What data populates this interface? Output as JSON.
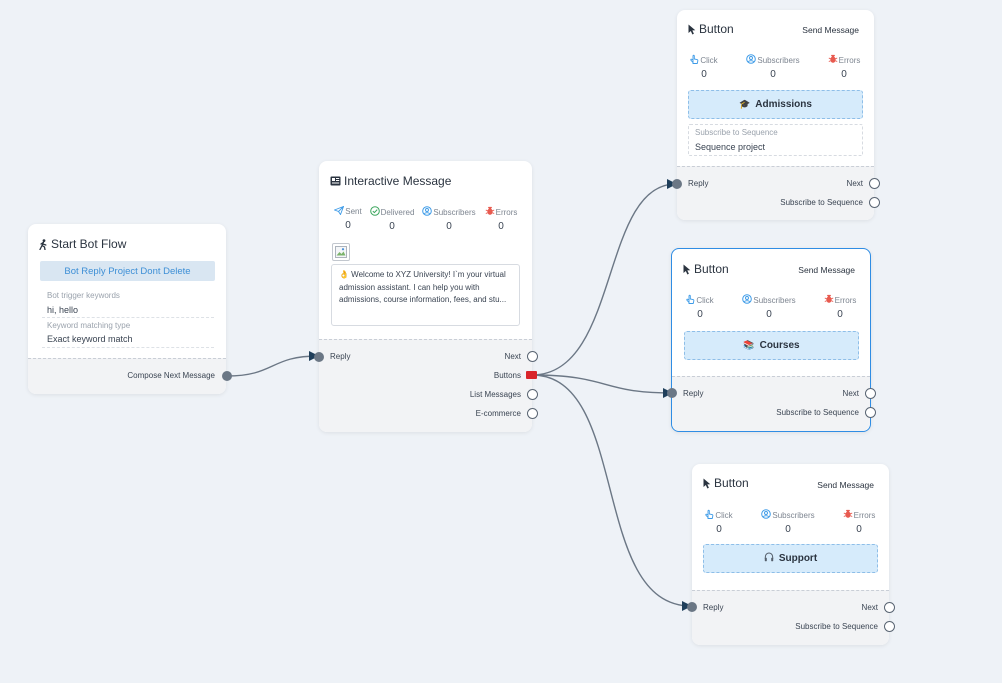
{
  "start_node": {
    "title": "Start Bot Flow",
    "reply_button": "Bot Reply Project Dont Delete",
    "keywords_label": "Bot trigger keywords",
    "keywords_value": "hi, hello",
    "match_label": "Keyword matching type",
    "match_value": "Exact keyword match",
    "output_label": "Compose Next Message"
  },
  "interactive_node": {
    "title": "Interactive Message",
    "stats": [
      {
        "label": "Sent",
        "value": "0",
        "icon": "send-icon"
      },
      {
        "label": "Delivered",
        "value": "0",
        "icon": "check-circle-icon"
      },
      {
        "label": "Subscribers",
        "value": "0",
        "icon": "user-circle-icon"
      },
      {
        "label": "Errors",
        "value": "0",
        "icon": "bug-icon"
      }
    ],
    "message_text": "👌 Welcome to XYZ University! I`m your virtual admission assistant. I can help you with admissions, course information, fees, and stu...",
    "input_label": "Reply",
    "outputs": [
      "Next",
      "Buttons",
      "List Messages",
      "E-commerce"
    ]
  },
  "button_nodes": [
    {
      "title": "Button",
      "action": "Send Message",
      "stats": [
        {
          "label": "Click",
          "value": "0"
        },
        {
          "label": "Subscribers",
          "value": "0"
        },
        {
          "label": "Errors",
          "value": "0"
        }
      ],
      "button_label": "Admissions",
      "button_emoji": "🎓",
      "sequence_label": "Subscribe to Sequence",
      "sequence_value": "Sequence project",
      "input_label": "Reply",
      "outputs": [
        "Next",
        "Subscribe to Sequence"
      ]
    },
    {
      "title": "Button",
      "action": "Send Message",
      "stats": [
        {
          "label": "Click",
          "value": "0"
        },
        {
          "label": "Subscribers",
          "value": "0"
        },
        {
          "label": "Errors",
          "value": "0"
        }
      ],
      "button_label": "Courses",
      "button_emoji": "📚",
      "input_label": "Reply",
      "outputs": [
        "Next",
        "Subscribe to Sequence"
      ]
    },
    {
      "title": "Button",
      "action": "Send Message",
      "stats": [
        {
          "label": "Click",
          "value": "0"
        },
        {
          "label": "Subscribers",
          "value": "0"
        },
        {
          "label": "Errors",
          "value": "0"
        }
      ],
      "button_label": "Support",
      "button_emoji": "🎧",
      "input_label": "Reply",
      "outputs": [
        "Next",
        "Subscribe to Sequence"
      ]
    }
  ],
  "colors": {
    "canvas": "#eef2f7",
    "accent": "#2f8de4",
    "connector": "#6b7785",
    "error": "#e85a4f",
    "active_port": "#d9252a"
  }
}
